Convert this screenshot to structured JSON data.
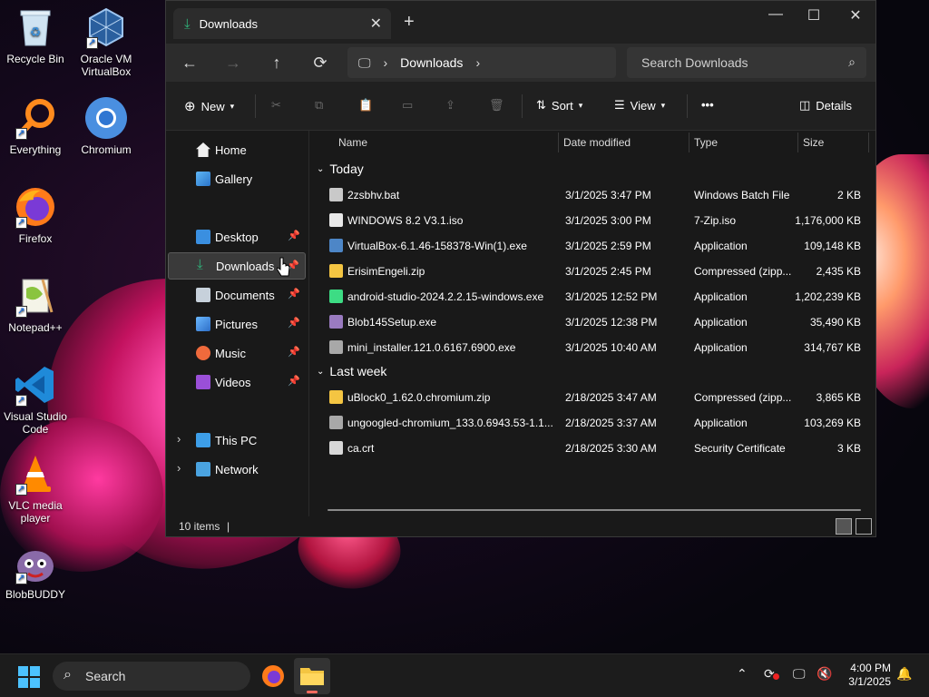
{
  "desktop": {
    "icons": [
      {
        "label": "Recycle Bin",
        "icon": "recycle-bin-icon"
      },
      {
        "label": "Oracle VM VirtualBox",
        "icon": "virtualbox-icon"
      },
      {
        "label": "Everything",
        "icon": "everything-search-icon"
      },
      {
        "label": "Chromium",
        "icon": "chromium-icon"
      },
      {
        "label": "Firefox",
        "icon": "firefox-icon"
      },
      {
        "label": "Notepad++",
        "icon": "notepadpp-icon"
      },
      {
        "label": "Visual Studio Code",
        "icon": "vscode-icon"
      },
      {
        "label": "VLC media player",
        "icon": "vlc-icon"
      },
      {
        "label": "BlobBUDDY",
        "icon": "blobbuddy-icon"
      }
    ]
  },
  "window": {
    "tab_title": "Downloads",
    "address": {
      "root_icon": "this-pc-icon",
      "segment": "Downloads"
    },
    "search_placeholder": "Search Downloads",
    "toolbar": {
      "new_label": "New",
      "sort_label": "Sort",
      "view_label": "View",
      "more_label": "•••",
      "details_label": "Details"
    },
    "sidebar": {
      "home": "Home",
      "gallery": "Gallery",
      "desktop": "Desktop",
      "downloads": "Downloads",
      "documents": "Documents",
      "pictures": "Pictures",
      "music": "Music",
      "videos": "Videos",
      "this_pc": "This PC",
      "network": "Network"
    },
    "columns": {
      "name": "Name",
      "date": "Date modified",
      "type": "Type",
      "size": "Size"
    },
    "groups": {
      "today": "Today",
      "last_week": "Last week"
    },
    "files_today": [
      {
        "name": "2zsbhv.bat",
        "date": "3/1/2025 3:47 PM",
        "type": "Windows Batch File",
        "size": "2 KB",
        "icon": "batch-file-icon"
      },
      {
        "name": "WINDOWS 8.2 V3.1.iso",
        "date": "3/1/2025 3:00 PM",
        "type": "7-Zip.iso",
        "size": "1,176,000 KB",
        "icon": "iso-file-icon"
      },
      {
        "name": "VirtualBox-6.1.46-158378-Win(1).exe",
        "date": "3/1/2025 2:59 PM",
        "type": "Application",
        "size": "109,148 KB",
        "icon": "virtualbox-installer-icon"
      },
      {
        "name": "ErisimEngeli.zip",
        "date": "3/1/2025 2:45 PM",
        "type": "Compressed (zipp...",
        "size": "2,435 KB",
        "icon": "zip-folder-icon"
      },
      {
        "name": "android-studio-2024.2.2.15-windows.exe",
        "date": "3/1/2025 12:52 PM",
        "type": "Application",
        "size": "1,202,239 KB",
        "icon": "android-studio-icon"
      },
      {
        "name": "Blob145Setup.exe",
        "date": "3/1/2025 12:38 PM",
        "type": "Application",
        "size": "35,490 KB",
        "icon": "blob-setup-icon"
      },
      {
        "name": "mini_installer.121.0.6167.6900.exe",
        "date": "3/1/2025 10:40 AM",
        "type": "Application",
        "size": "314,767 KB",
        "icon": "chromium-installer-icon"
      }
    ],
    "files_last_week": [
      {
        "name": "uBlock0_1.62.0.chromium.zip",
        "date": "2/18/2025 3:47 AM",
        "type": "Compressed (zipp...",
        "size": "3,865 KB",
        "icon": "zip-folder-icon"
      },
      {
        "name": "ungoogled-chromium_133.0.6943.53-1.1...",
        "date": "2/18/2025 3:37 AM",
        "type": "Application",
        "size": "103,269 KB",
        "icon": "chromium-installer-icon"
      },
      {
        "name": "ca.crt",
        "date": "2/18/2025 3:30 AM",
        "type": "Security Certificate",
        "size": "3 KB",
        "icon": "certificate-icon"
      }
    ],
    "status": {
      "item_count": "10 items"
    }
  },
  "taskbar": {
    "search_label": "Search",
    "clock": {
      "time": "4:00 PM",
      "date": "3/1/2025"
    }
  },
  "colors": {
    "window_bg": "#191919",
    "titlebar_bg": "#202020",
    "accent_download": "#2fb37a",
    "folder_yellow": "#f4c542"
  }
}
